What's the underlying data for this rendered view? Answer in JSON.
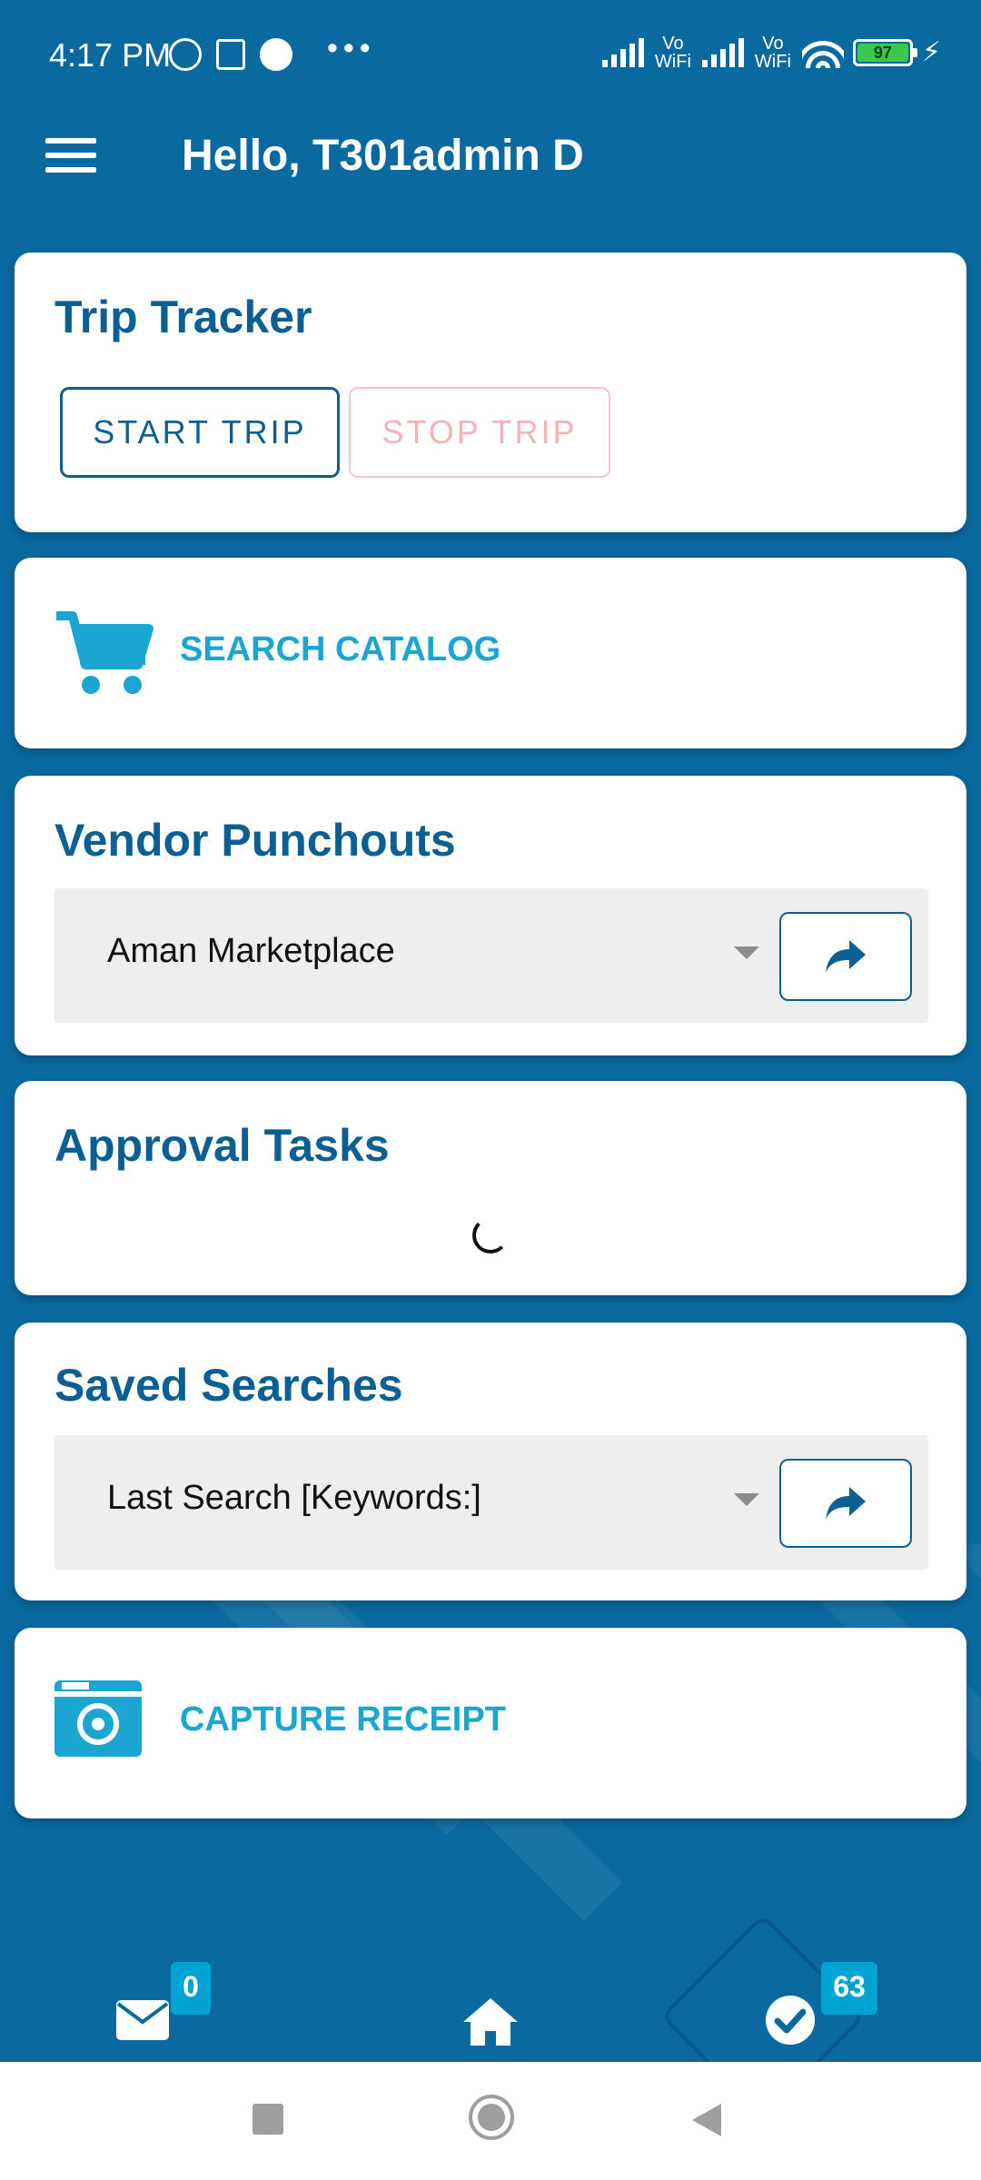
{
  "status_bar": {
    "time": "4:17 PM",
    "vowifi_label_1": "Vo\nWiFi",
    "vowifi_label_2": "Vo\nWiFi",
    "battery": "97"
  },
  "header": {
    "greeting": "Hello, T301admin D"
  },
  "trip_tracker": {
    "title": "Trip Tracker",
    "start_label": "START TRIP",
    "stop_label": "STOP TRIP"
  },
  "search_catalog": {
    "label": "SEARCH CATALOG"
  },
  "vendor_punchouts": {
    "title": "Vendor Punchouts",
    "selected": "Aman Marketplace"
  },
  "approval_tasks": {
    "title": "Approval Tasks"
  },
  "saved_searches": {
    "title": "Saved Searches",
    "selected": "Last Search [Keywords:]"
  },
  "capture_receipt": {
    "label": "CAPTURE RECEIPT"
  },
  "bottom_nav": {
    "mail_count": "0",
    "tasks_count": "63"
  },
  "colors": {
    "primary": "#0a6aa0",
    "title_blue": "#0b5f92",
    "accent_cyan": "#1aa6d0",
    "stop_pink": "#f5b2b5",
    "badge": "#00a3d1"
  }
}
